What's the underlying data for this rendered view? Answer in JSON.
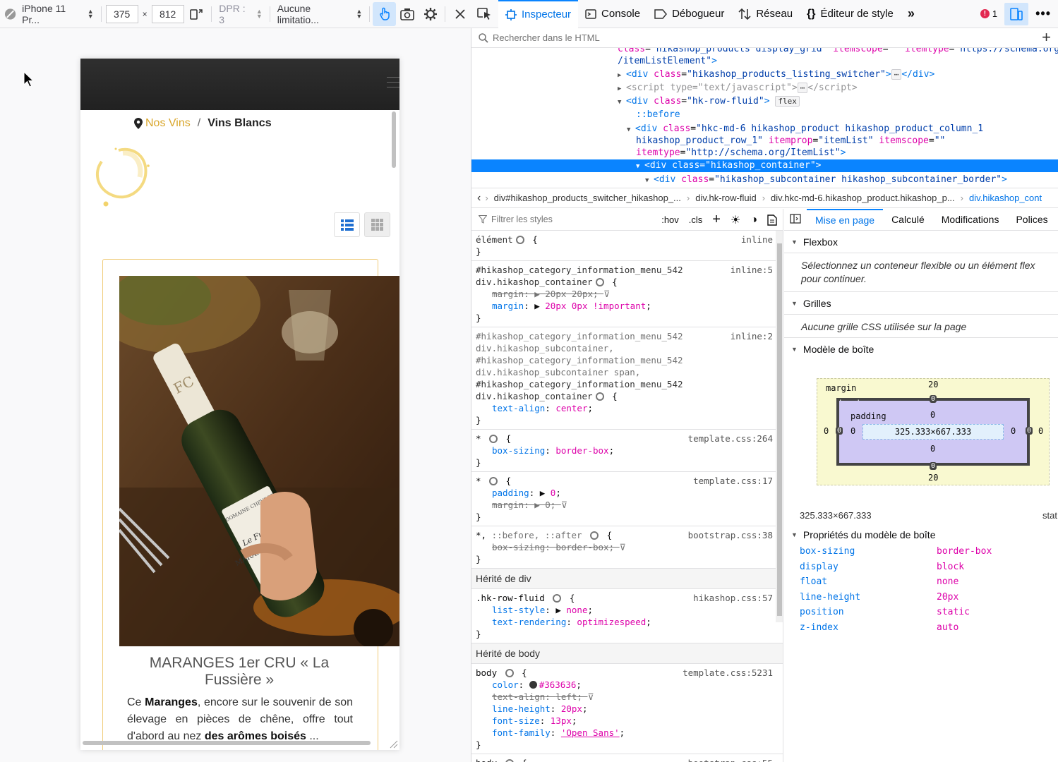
{
  "rdm": {
    "device": "iPhone 11 Pr...",
    "width": "375",
    "height": "812",
    "times": "×",
    "dpr": "DPR : 3",
    "throttle": "Aucune limitatio..."
  },
  "site": {
    "breadcrumb": {
      "link": "Nos Vins",
      "sep": "/",
      "current": "Vins Blancs"
    },
    "product_title": "MARANGES 1er CRU « La Fussière »",
    "desc_1": "Ce ",
    "desc_b1": "Maranges",
    "desc_2": ", encore sur le souvenir de son élevage en pièces de chêne, offre tout d'abord au nez ",
    "desc_b2": "des arômes boisés",
    "desc_3": " ...",
    "label_line1": "Le Fussière",
    "label_line2": "MARANGES 1er CRU",
    "label_top": "DOMAINE CHEVROT",
    "bottle_seal": "FC"
  },
  "devtools": {
    "tabs": [
      "Inspecteur",
      "Console",
      "Débogueur",
      "Réseau",
      "Éditeur de style"
    ],
    "error_count": "1",
    "search_placeholder": "Rechercher dans le HTML",
    "breadcrumbs": [
      "div#hikashop_products_switcher_hikashop_...",
      "div.hk-row-fluid",
      "div.hkc-md-6.hikashop_product.hikashop_p...",
      "div.hikashop_cont"
    ],
    "filter_placeholder": "Filtrer les styles",
    "hov": ":hov",
    "cls": ".cls",
    "layout_tabs": [
      "Mise en page",
      "Calculé",
      "Modifications",
      "Polices"
    ],
    "flexbox": "Flexbox",
    "flexbox_msg": "Sélectionnez un conteneur flexible ou un élément flex pour continuer.",
    "grilles": "Grilles",
    "grilles_msg": "Aucune grille CSS utilisée sur la page",
    "boxmodel_title": "Modèle de boîte",
    "bm": {
      "margin_label": "margin",
      "border_label": "border",
      "padding_label": "padding",
      "margin_top": "20",
      "margin_bottom": "20",
      "margin_left": "0",
      "margin_right": "0",
      "border_top": "0",
      "border_bottom": "0",
      "border_left": "0",
      "border_right": "0",
      "padding_top": "0",
      "padding_bottom": "0",
      "padding_left": "0",
      "padding_right": "0",
      "content": "325.333×667.333"
    },
    "bm_size": "325.333×667.333",
    "bm_position": "stat",
    "props_title": "Propriétés du modèle de boîte",
    "props": [
      {
        "k": "box-sizing",
        "v": "border-box"
      },
      {
        "k": "display",
        "v": "block"
      },
      {
        "k": "float",
        "v": "none"
      },
      {
        "k": "line-height",
        "v": "20px"
      },
      {
        "k": "position",
        "v": "static"
      },
      {
        "k": "z-index",
        "v": "auto"
      }
    ],
    "inherited_div": "Hérité de div",
    "inherited_body": "Hérité de body"
  }
}
